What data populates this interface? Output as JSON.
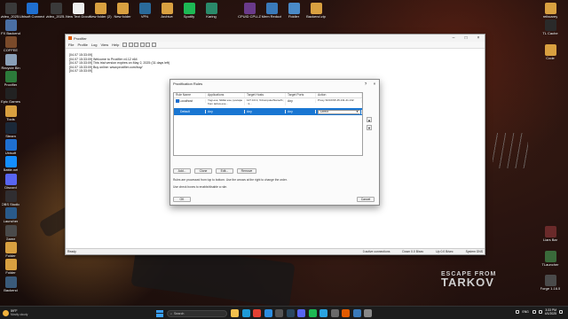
{
  "desktop_left_icons": [
    {
      "label": "video_2025..",
      "color": "#3a3a3a"
    },
    {
      "label": "Ubisoft Connect",
      "color": "#1f6fd0"
    },
    {
      "label": "FX Backend",
      "color": "#4a6fa5"
    },
    {
      "label": "COFFEE",
      "color": "#7a4a2a"
    },
    {
      "label": "Recycle Bin",
      "color": "#8aa0b8"
    },
    {
      "label": "Proxifier",
      "color": "#2c7a3a"
    },
    {
      "label": "Epic Games",
      "color": "#222222"
    },
    {
      "label": "Tools",
      "color": "#d9a040"
    },
    {
      "label": "Steam",
      "color": "#1b2838"
    },
    {
      "label": "Ubisoft",
      "color": "#1f6fd0"
    },
    {
      "label": "Battle.net",
      "color": "#148eff"
    },
    {
      "label": "Discord",
      "color": "#5865f2"
    },
    {
      "label": "OBS Studio",
      "color": "#302e31"
    },
    {
      "label": "Launcher",
      "color": "#2a5a8a"
    },
    {
      "label": "Game",
      "color": "#4a4a4a"
    },
    {
      "label": "Folder",
      "color": "#d9a040"
    },
    {
      "label": "Folder",
      "color": "#d9a040"
    },
    {
      "label": "Backend",
      "color": "#3a5a7a"
    }
  ],
  "desktop_top_icons": [
    {
      "label": "video_2025..",
      "color": "#3a3a3a"
    },
    {
      "label": "New Text Document",
      "color": "#eeeeee"
    },
    {
      "label": "New folder (2)",
      "color": "#d9a040"
    },
    {
      "label": "New folder",
      "color": "#d9a040"
    },
    {
      "label": "VPN",
      "color": "#2a6a9a"
    },
    {
      "label": "Archive",
      "color": "#d9a040"
    },
    {
      "label": "Spotify",
      "color": "#1db954"
    },
    {
      "label": "Karing",
      "color": "#2a8a6a"
    },
    {
      "label": "CPUID CPU-Z",
      "color": "#6a3a8a"
    },
    {
      "label": "Mem Reduct",
      "color": "#3a7aba"
    },
    {
      "label": "Fiddler",
      "color": "#4a8ac8"
    },
    {
      "label": "Backend.zip",
      "color": "#d9a040"
    }
  ],
  "desktop_right_icons": [
    {
      "label": "reibcarey",
      "color": "#d9a040"
    },
    {
      "label": "TL Cache",
      "color": "#2a2a2a"
    },
    {
      "label": "Code",
      "color": "#d9a040"
    },
    {
      "label": "Liars Bar",
      "color": "#6a2a2a"
    },
    {
      "label": "TLauncher",
      "color": "#3a6a3a"
    },
    {
      "label": "Forge 1.16.5",
      "color": "#4a4a4a"
    }
  ],
  "escape_logo": {
    "line1": "ESCAPE FROM",
    "line2": "TARKOV"
  },
  "window": {
    "title": "Proxifier",
    "menu": [
      "File",
      "Profile",
      "Log",
      "View",
      "Help"
    ],
    "log_lines": [
      "[04.07 15:33:09]",
      "[04.07 15:33:09]    Welcome to Proxifier v4.12 x64",
      "[04.07 15:33:09]    This trial version expires on May 2, 2025 (31 days left)",
      "[04.07 15:33:09]    Buy online: www.proxifier.com/buy/",
      "[04.07 15:33:09]"
    ],
    "status": {
      "left": "Ready",
      "connections": "0 active connections",
      "down": "Down 0.0 B/sec",
      "up": "Up 0.0 B/sec",
      "dns": "System DNS"
    }
  },
  "dialog": {
    "title": "Proxification Rules",
    "help": "?",
    "close": "×",
    "columns": [
      "Rule Name",
      "Applications",
      "Target Hosts",
      "Target Ports",
      "Action"
    ],
    "rules": [
      {
        "name": "Localhost",
        "apps": "Yogi.exe; fiddler.exe; (escape from tarkov.exe...",
        "hosts": "127.0.0.1; %ComputerName%; ::1...",
        "ports": "Any",
        "action": "Proxy SOCKS5 45.131.21.132"
      },
      {
        "name": "Default",
        "apps": "Any",
        "hosts": "Any",
        "ports": "Any",
        "action": "Direct"
      }
    ],
    "buttons": {
      "add": "Add...",
      "clone": "Clone",
      "edit": "Edit...",
      "remove": "Remove"
    },
    "note1": "Rules are processed from top to bottom. Use the arrows at the right to change the order.",
    "note2": "Use check boxes to enable/disable a rule.",
    "ok": "OK",
    "cancel": "Cancel",
    "up_arrow": "▲",
    "down_arrow": "▼"
  },
  "taskbar": {
    "weather_temp": "59°F",
    "weather_desc": "Mostly cloudy",
    "search_placeholder": "Search",
    "apps": [
      {
        "name": "file-explorer",
        "color": "#f2c14e"
      },
      {
        "name": "edge",
        "color": "#1f9ad6"
      },
      {
        "name": "chrome",
        "color": "#e34133"
      },
      {
        "name": "vscode",
        "color": "#2c8de0"
      },
      {
        "name": "terminal",
        "color": "#555555"
      },
      {
        "name": "steam",
        "color": "#2a475e"
      },
      {
        "name": "discord",
        "color": "#5865f2"
      },
      {
        "name": "spotify",
        "color": "#1db954"
      },
      {
        "name": "telegram",
        "color": "#2aa3e0"
      },
      {
        "name": "obs",
        "color": "#6a6a6a"
      },
      {
        "name": "proxifier",
        "color": "#e05a00"
      },
      {
        "name": "notepad",
        "color": "#3a7aba"
      },
      {
        "name": "settings",
        "color": "#888888"
      }
    ],
    "lang": "ENG",
    "time": "3:33 PM",
    "date": "4/1/2025"
  }
}
